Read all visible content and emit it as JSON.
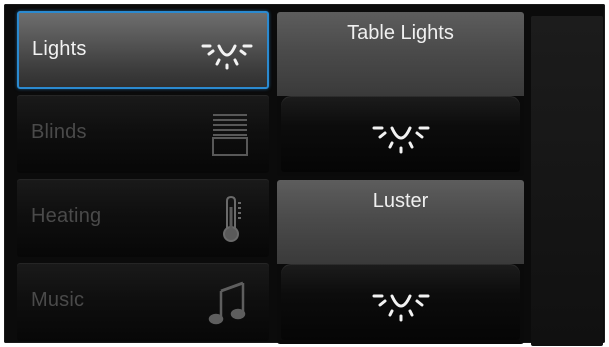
{
  "sidebar": {
    "items": [
      {
        "label": "Lights",
        "icon": "light-bulb-icon",
        "active": true
      },
      {
        "label": "Blinds",
        "icon": "blinds-icon",
        "active": false
      },
      {
        "label": "Heating",
        "icon": "thermometer-icon",
        "active": false
      },
      {
        "label": "Music",
        "icon": "music-note-icon",
        "active": false
      }
    ]
  },
  "tiles": [
    {
      "title": "Table Lights",
      "icon": "light-bulb-icon"
    },
    {
      "title": "Luster",
      "icon": "light-bulb-icon"
    }
  ],
  "colors": {
    "accent": "#2b8ad0",
    "active_text": "#f2f2f2",
    "inactive_text": "#4a4a4a"
  }
}
